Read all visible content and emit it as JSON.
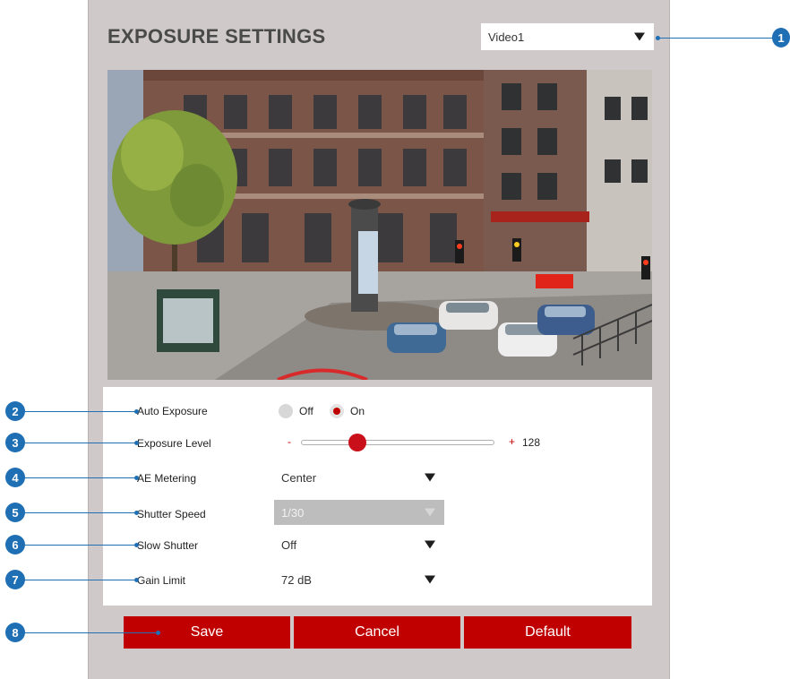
{
  "page": {
    "title": "EXPOSURE SETTINGS",
    "video_select": {
      "value": "Video1"
    }
  },
  "settings": {
    "auto_exposure": {
      "label": "Auto Exposure",
      "options": [
        "Off",
        "On"
      ],
      "selected": "On"
    },
    "exposure_level": {
      "label": "Exposure Level",
      "minus": "-",
      "plus": "+",
      "value": "128",
      "fraction": 0.29
    },
    "ae_metering": {
      "label": "AE Metering",
      "value": "Center"
    },
    "shutter_speed": {
      "label": "Shutter Speed",
      "value": "1/30",
      "disabled": true
    },
    "slow_shutter": {
      "label": "Slow Shutter",
      "value": "Off"
    },
    "gain_limit": {
      "label": "Gain Limit",
      "value": "72 dB"
    }
  },
  "buttons": {
    "save": "Save",
    "cancel": "Cancel",
    "default": "Default"
  },
  "callouts": [
    "1",
    "2",
    "3",
    "4",
    "5",
    "6",
    "7",
    "8"
  ],
  "colors": {
    "accent_red": "#c00000",
    "callout_blue": "#1f6fb5",
    "panel_bg": "#cfc9c9"
  }
}
